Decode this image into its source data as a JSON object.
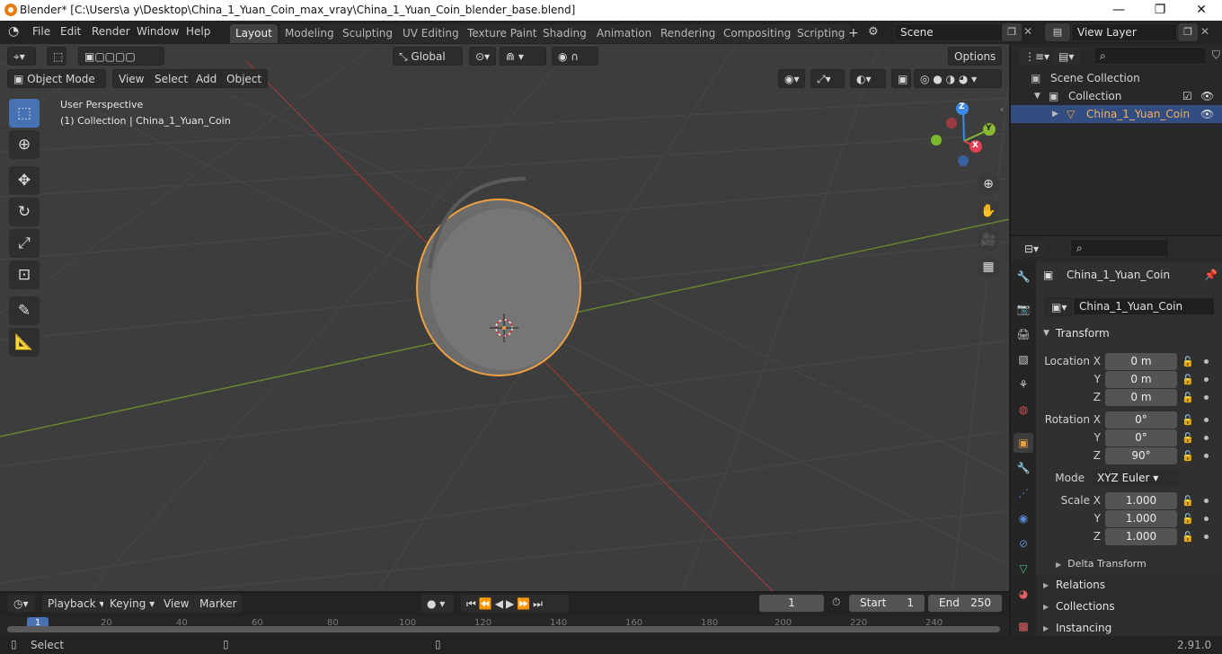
{
  "window": {
    "title": "Blender* [C:\\Users\\a y\\Desktop\\China_1_Yuan_Coin_max_vray\\China_1_Yuan_Coin_blender_base.blend]",
    "minimize": "—",
    "maximize": "❐",
    "close": "✕"
  },
  "menu": [
    "File",
    "Edit",
    "Render",
    "Window",
    "Help"
  ],
  "workspaces": [
    "Layout",
    "Modeling",
    "Sculpting",
    "UV Editing",
    "Texture Paint",
    "Shading",
    "Animation",
    "Rendering",
    "Compositing",
    "Scripting"
  ],
  "scene": {
    "label": "Scene",
    "view_layer": "View Layer"
  },
  "viewport_header": {
    "orientation": "Global",
    "options": "Options",
    "mode": "Object Mode",
    "menus": [
      "View",
      "Select",
      "Add",
      "Object"
    ]
  },
  "overlay_text": {
    "perspective": "User Perspective",
    "collection": "(1) Collection | China_1_Yuan_Coin"
  },
  "gizmo": {
    "x": "X",
    "y": "Y",
    "z": "Z"
  },
  "outliner": {
    "root": "Scene Collection",
    "collection": "Collection",
    "object": "China_1_Yuan_Coin"
  },
  "properties": {
    "object_name": "China_1_Yuan_Coin",
    "data_name": "China_1_Yuan_Coin",
    "transform_label": "Transform",
    "location_label": "Location X",
    "location": [
      "0 m",
      "0 m",
      "0 m"
    ],
    "rotation_label": "Rotation X",
    "rotation": [
      "0°",
      "0°",
      "90°"
    ],
    "mode_label": "Mode",
    "mode_value": "XYZ Euler",
    "scale_label": "Scale X",
    "scale": [
      "1.000",
      "1.000",
      "1.000"
    ],
    "axis_y": "Y",
    "axis_z": "Z",
    "delta": "Delta Transform",
    "relations": "Relations",
    "collections": "Collections",
    "instancing": "Instancing"
  },
  "timeline": {
    "menus": [
      "Playback",
      "Keying",
      "View",
      "Marker"
    ],
    "current_frame": "1",
    "start_label": "Start",
    "start": "1",
    "end_label": "End",
    "end": "250",
    "ticks": [
      "1",
      "20",
      "40",
      "60",
      "80",
      "100",
      "120",
      "140",
      "160",
      "180",
      "200",
      "220",
      "240"
    ]
  },
  "status": {
    "select": "Select",
    "version": "2.91.0"
  }
}
